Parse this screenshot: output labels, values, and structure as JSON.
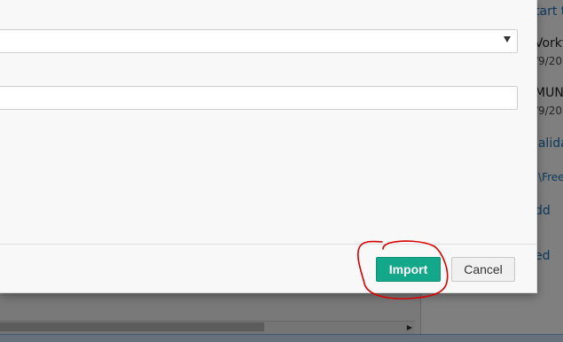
{
  "background_app": {
    "right_panel_items": [
      {
        "text": "tart t",
        "kind": "link"
      },
      {
        "text": "Vorkf",
        "kind": "normal"
      },
      {
        "text": "/9/20",
        "kind": "small"
      },
      {
        "text": "MUNI",
        "kind": "normal"
      },
      {
        "text": "/9/20",
        "kind": "small"
      },
      {
        "text": "'alida",
        "kind": "link"
      },
      {
        "text": ":\\Free",
        "kind": "link"
      },
      {
        "text": "dd",
        "kind": "link"
      },
      {
        "text": "ed",
        "kind": "link"
      }
    ]
  },
  "dialog": {
    "select": {
      "value": ""
    },
    "text_input": {
      "value": ""
    },
    "buttons": {
      "import": "Import",
      "cancel": "Cancel"
    }
  },
  "colors": {
    "primary_button": "#13a88a",
    "annotation": "#d90000"
  },
  "icons": {
    "select_arrow": "chevron-down-icon",
    "scroll_right": "arrow-right-icon"
  }
}
